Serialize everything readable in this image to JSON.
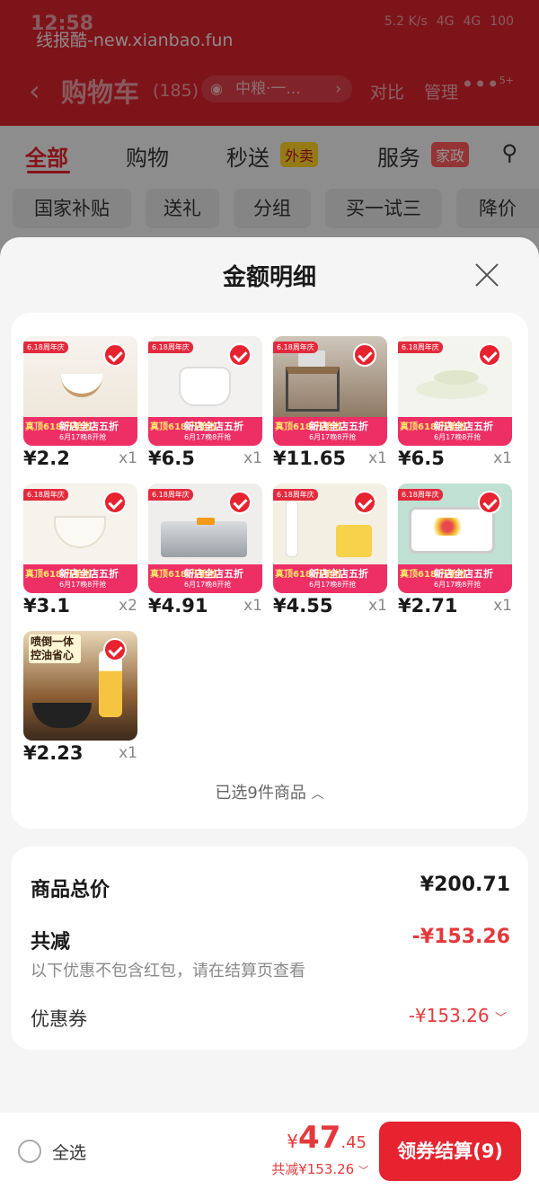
{
  "status_bar": {
    "time": "12:58",
    "icons": [
      "5.2 K/s",
      "4G",
      "4G",
      "100"
    ]
  },
  "watermark": "线报酷-new.xianbao.fun",
  "nav": {
    "title": "购物车",
    "count": "(185)",
    "address": "中粮·一...",
    "compare": "对比",
    "manage": "管理",
    "more_badge": "5+"
  },
  "tabs": [
    {
      "label": "全部",
      "active": true
    },
    {
      "label": "购物"
    },
    {
      "label": "秒送",
      "badge": "外卖"
    },
    {
      "label": "服务",
      "badge": "家政"
    }
  ],
  "chips": [
    "国家补贴",
    "送礼",
    "分组",
    "买一试三",
    "降价"
  ],
  "sheet": {
    "title": "金额明细"
  },
  "promo": {
    "tag": "6.18周年庆",
    "badge": "真顶618 开抢啦",
    "title": "新店全店五折",
    "sub": "6月17晚8开抢"
  },
  "items": [
    {
      "price": "¥2.2",
      "qty": "x1"
    },
    {
      "price": "¥6.5",
      "qty": "x1"
    },
    {
      "price": "¥11.65",
      "qty": "x1"
    },
    {
      "price": "¥6.5",
      "qty": "x1"
    },
    {
      "price": "¥3.1",
      "qty": "x2"
    },
    {
      "price": "¥4.91",
      "qty": "x1"
    },
    {
      "price": "¥4.55",
      "qty": "x1"
    },
    {
      "price": "¥2.71",
      "qty": "x1"
    },
    {
      "price": "¥2.23",
      "qty": "x1",
      "thumb_text": "喷倒一体 控油省心"
    }
  ],
  "selected_text": "已选9件商品",
  "summary": {
    "total_label": "商品总价",
    "total_value": "¥200.71",
    "discount_label": "共减",
    "discount_value": "-¥153.26",
    "note": "以下优惠不包含红包，请在结算页查看",
    "coupon_label": "优惠券",
    "coupon_value": "-¥153.26"
  },
  "bottom_bar": {
    "select_all": "全选",
    "currency": "¥",
    "total_int": "47",
    "total_dec": ".45",
    "reduced": "共减¥153.26",
    "checkout": "领券结算(9)"
  }
}
